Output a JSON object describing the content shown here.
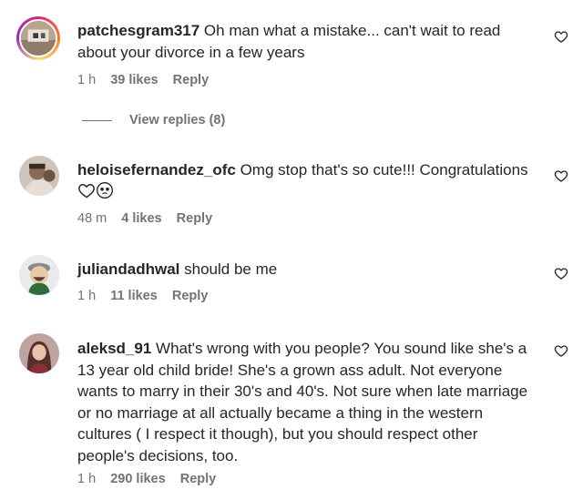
{
  "comments": [
    {
      "username": "patchesgram317",
      "text": "Oh man what a mistake... can't wait to read about your divorce in a few years",
      "time": "1 h",
      "likes": "39 likes",
      "reply": "Reply",
      "view_replies": "View replies (8)"
    },
    {
      "username": "heloisefernandez_ofc",
      "text": "Omg stop that's so cute!!! Congratulations",
      "time": "48 m",
      "likes": "4 likes",
      "reply": "Reply"
    },
    {
      "username": "juliandadhwal",
      "text": "should be me",
      "time": "1 h",
      "likes": "11 likes",
      "reply": "Reply"
    },
    {
      "username": "aleksd_91",
      "text": "What's wrong with you people? You sound like she's a 13 year old child bride! She's a grown ass adult. Not everyone wants to marry in their 30's and 40's. Not sure when late marriage or no marriage at all actually became a thing in the western cultures ( I respect it though), but you should respect other people's decisions, too.",
      "time": "1 h",
      "likes": "290 likes",
      "reply": "Reply"
    }
  ],
  "icons": {
    "like": "heart-outline-icon",
    "emoji_heart": "white-heart-emoji",
    "emoji_face": "pleading-face-emoji"
  },
  "colors": {
    "text": "#262626",
    "secondary": "#737373",
    "story_ring": "#d62976"
  }
}
